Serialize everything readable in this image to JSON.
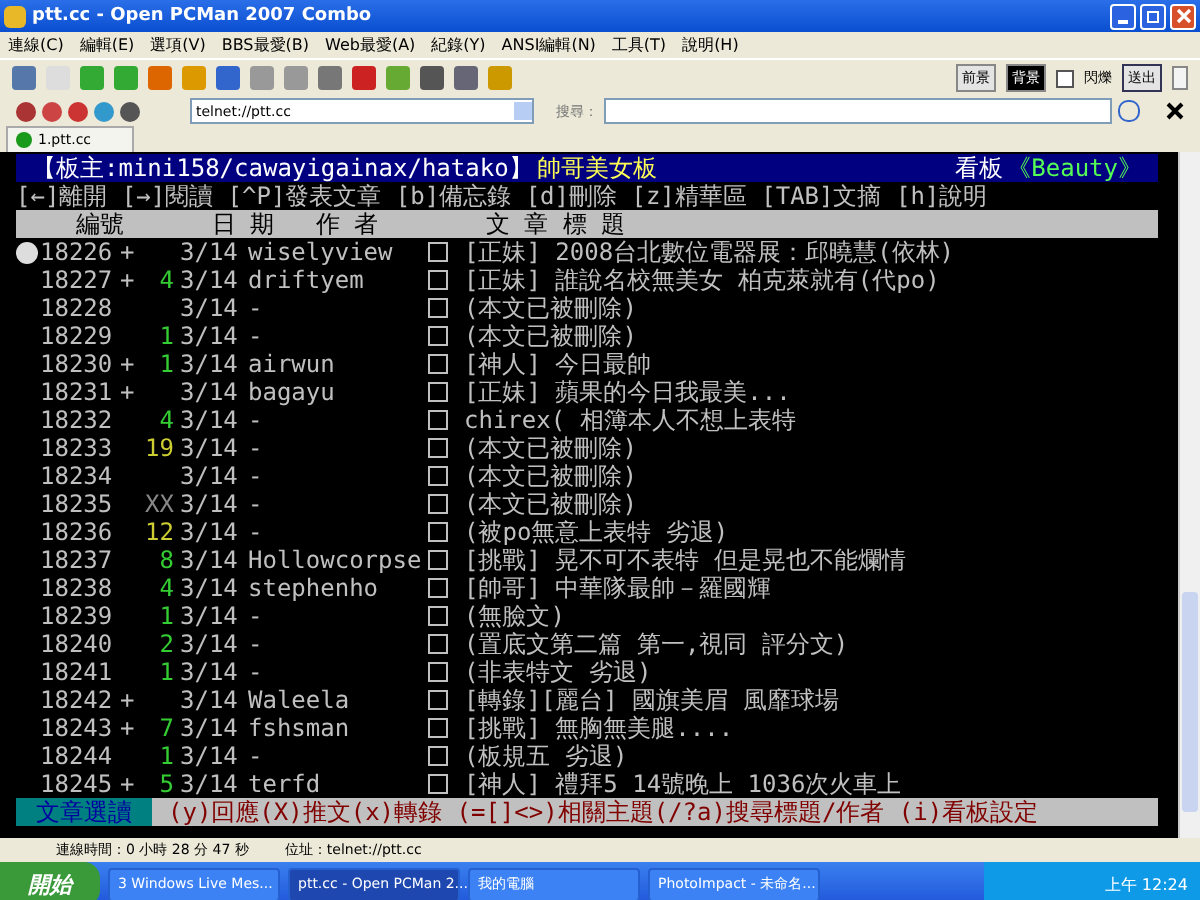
{
  "window": {
    "title": "ptt.cc - Open PCMan 2007 Combo"
  },
  "menu": [
    "連線(C)",
    "編輯(E)",
    "選項(V)",
    "BBS最愛(B)",
    "Web最愛(A)",
    "紀錄(Y)",
    "ANSI編輯(N)",
    "工具(T)",
    "說明(H)"
  ],
  "toolbar_right": {
    "buttons": [
      {
        "label": "前景",
        "selected": false
      },
      {
        "label": "背景",
        "selected": true
      }
    ],
    "blink": {
      "label": "閃爍",
      "checked": false
    },
    "send": "送出"
  },
  "address_bar": {
    "value": "telnet://ptt.cc",
    "search_label": "搜尋："
  },
  "tabs": [
    {
      "label": "1.ptt.cc",
      "selected": true
    }
  ],
  "terminal": {
    "header": {
      "moderators": "【板主:mini158/cawayigainax/hatako】",
      "board_title": "帥哥美女板",
      "board_prefix": "看板",
      "board_id": "《Beauty》"
    },
    "help_line": "[←]離開 [→]閱讀 [^P]發表文章 [b]備忘錄 [d]刪除 [z]精華區 [TAB]文摘 [h]說明",
    "columns": [
      "編號",
      "日 期",
      "作 者",
      "文 章 標 題"
    ],
    "rows": [
      {
        "number": "18226",
        "mark": "+",
        "date": "3/14",
        "author": "wiselyview",
        "title": "[正妹] 2008台北數位電器展：邱曉慧(依林)",
        "selected": true
      },
      {
        "number": "18227",
        "mark": "+",
        "push": {
          "text": "4",
          "color": "#33cc33"
        },
        "date": "3/14",
        "author": "driftyem",
        "title": "[正妹] 誰說名校無美女 柏克萊就有(代po)",
        "selected": false
      },
      {
        "number": "18228",
        "date": "3/14",
        "author": "-",
        "title": "(本文已被刪除)",
        "selected": false
      },
      {
        "number": "18229",
        "push": {
          "text": "1",
          "color": "#33cc33"
        },
        "date": "3/14",
        "author": "-",
        "title": "(本文已被刪除)",
        "selected": false
      },
      {
        "number": "18230",
        "mark": "+",
        "push": {
          "text": "1",
          "color": "#33cc33"
        },
        "date": "3/14",
        "author": "airwun",
        "title": "[神人] 今日最帥",
        "selected": false
      },
      {
        "number": "18231",
        "mark": "+",
        "date": "3/14",
        "author": "bagayu",
        "title": "[正妹] 蘋果的今日我最美...",
        "selected": false
      },
      {
        "number": "18232",
        "push": {
          "text": "4",
          "color": "#33cc33"
        },
        "date": "3/14",
        "author": "-",
        "title": "chirex( 相簿本人不想上表特",
        "selected": false
      },
      {
        "number": "18233",
        "push": {
          "text": "19",
          "color": "#cccc33"
        },
        "date": "3/14",
        "author": "-",
        "title": "(本文已被刪除)",
        "selected": false
      },
      {
        "number": "18234",
        "date": "3/14",
        "author": "-",
        "title": "(本文已被刪除)",
        "selected": false
      },
      {
        "number": "18235",
        "push": {
          "text": "XX",
          "color": "#888888"
        },
        "date": "3/14",
        "author": "-",
        "title": "(本文已被刪除)",
        "selected": false
      },
      {
        "number": "18236",
        "push": {
          "text": "12",
          "color": "#cccc33"
        },
        "date": "3/14",
        "author": "-",
        "title": "(被po無意上表特 劣退)",
        "selected": false
      },
      {
        "number": "18237",
        "push": {
          "text": "8",
          "color": "#33cc33"
        },
        "date": "3/14",
        "author": "Hollowcorpse",
        "title": "[挑戰] 晃不可不表特  但是晃也不能爛情",
        "selected": false
      },
      {
        "number": "18238",
        "push": {
          "text": "4",
          "color": "#33cc33"
        },
        "date": "3/14",
        "author": "stephenho",
        "title": "[帥哥] 中華隊最帥－羅國輝",
        "selected": false
      },
      {
        "number": "18239",
        "push": {
          "text": "1",
          "color": "#33cc33"
        },
        "date": "3/14",
        "author": "-",
        "title": "(無臉文)",
        "selected": false
      },
      {
        "number": "18240",
        "push": {
          "text": "2",
          "color": "#33cc33"
        },
        "date": "3/14",
        "author": "-",
        "title": "(置底文第二篇 第一,視同 評分文)",
        "selected": false
      },
      {
        "number": "18241",
        "push": {
          "text": "1",
          "color": "#33cc33"
        },
        "date": "3/14",
        "author": "-",
        "title": "(非表特文 劣退)",
        "selected": false
      },
      {
        "number": "18242",
        "mark": "+",
        "date": "3/14",
        "author": "Waleela",
        "title": "[轉錄][麗台] 國旗美眉 風靡球場",
        "selected": false
      },
      {
        "number": "18243",
        "mark": "+",
        "push": {
          "text": "7",
          "color": "#33cc33"
        },
        "date": "3/14",
        "author": "fshsman",
        "title": "[挑戰] 無胸無美腿....",
        "selected": false
      },
      {
        "number": "18244",
        "push": {
          "text": "1",
          "color": "#33cc33"
        },
        "date": "3/14",
        "author": "-",
        "title": "(板規五 劣退)",
        "selected": false
      },
      {
        "number": "18245",
        "mark": "+",
        "push": {
          "text": "5",
          "color": "#33cc33"
        },
        "date": "3/14",
        "author": "terfd",
        "title": "[神人] 禮拜5 14號晚上 1036次火車上",
        "selected": false
      }
    ],
    "footer": {
      "mode": "文章選讀",
      "keys": "(y)回應(X)推文(x)轉錄 (=[]<>)相關主題(/?a)搜尋標題/作者 (i)看板設定"
    }
  },
  "status_bar": {
    "connection_time": "連線時間：0 小時 28 分 47 秒",
    "address": "位址：telnet://ptt.cc"
  },
  "taskbar": {
    "start": "開始",
    "tasks": [
      {
        "label": "3 Windows Live Mes...",
        "selected": false
      },
      {
        "label": "ptt.cc - Open PCMan 2...",
        "selected": true
      },
      {
        "label": "我的電腦",
        "selected": false
      },
      {
        "label": "PhotoImpact - 未命名...",
        "selected": false
      }
    ],
    "clock": "上午 12:24"
  }
}
